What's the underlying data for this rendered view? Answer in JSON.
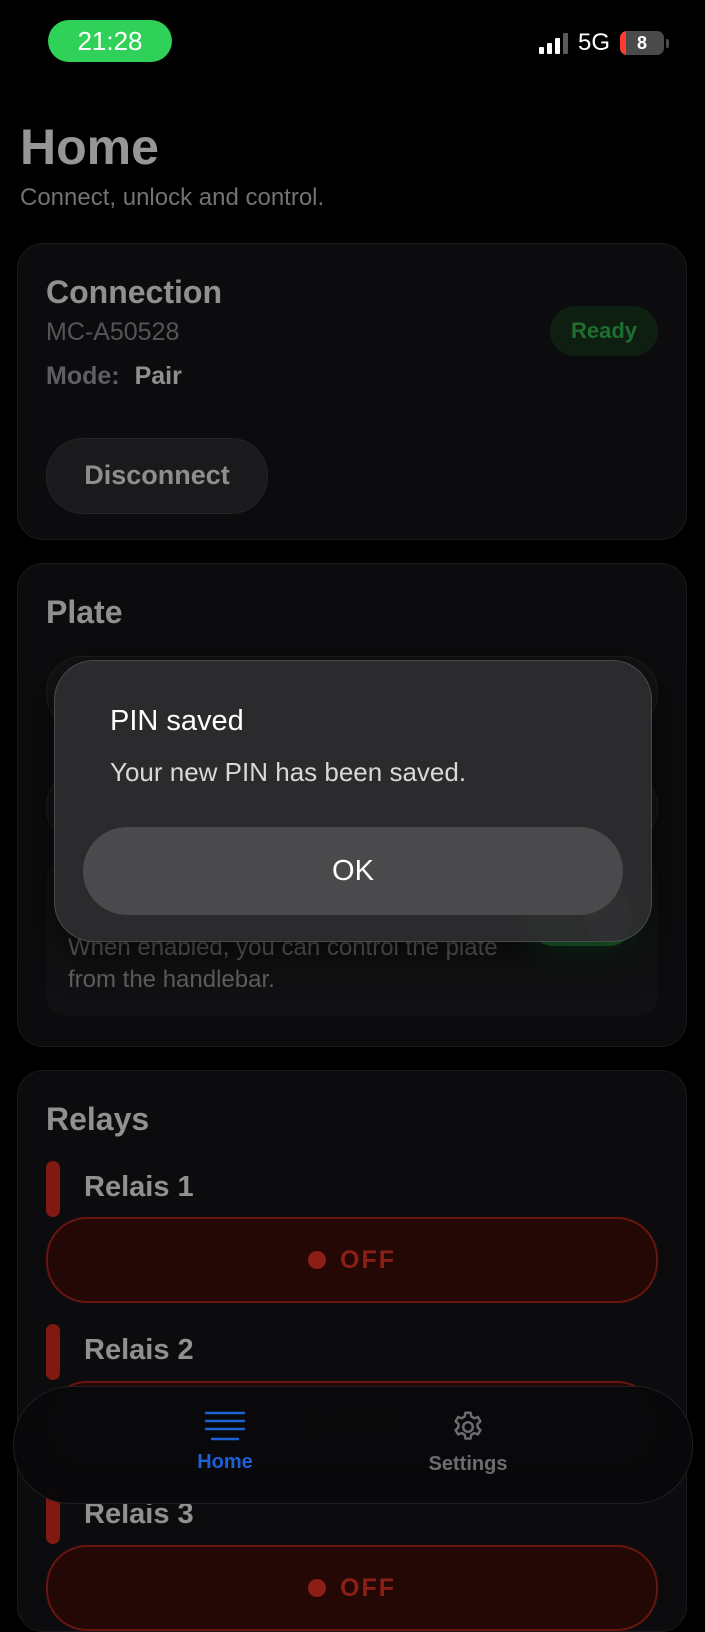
{
  "status_bar": {
    "time": "21:28",
    "network": "5G",
    "battery": "8"
  },
  "header": {
    "title": "Home",
    "subtitle": "Connect, unlock and control."
  },
  "connection": {
    "title": "Connection",
    "device_id": "MC-A50528",
    "mode_label": "Mode:",
    "mode_value": "Pair",
    "status_badge": "Ready",
    "disconnect_label": "Disconnect"
  },
  "plate": {
    "title": "Plate",
    "handlebar_desc": "When enabled, you can control the plate from the handlebar.",
    "handlebar_toggle_on": true
  },
  "relays": {
    "title": "Relays",
    "items": [
      {
        "label": "Relais 1",
        "state": "OFF"
      },
      {
        "label": "Relais 2",
        "state": "OFF"
      },
      {
        "label": "Relais 3",
        "state": "OFF"
      }
    ]
  },
  "alert": {
    "title": "PIN saved",
    "message": "Your new PIN has been saved.",
    "ok_label": "OK"
  },
  "tabbar": {
    "home_label": "Home",
    "settings_label": "Settings",
    "active": "Home"
  },
  "colors": {
    "accent_green": "#2fd158",
    "relay_red": "#d0291f",
    "tab_active": "#1f5fd6"
  },
  "icons": {
    "home_tab": "list-lines-icon",
    "settings_tab": "gear-icon"
  }
}
